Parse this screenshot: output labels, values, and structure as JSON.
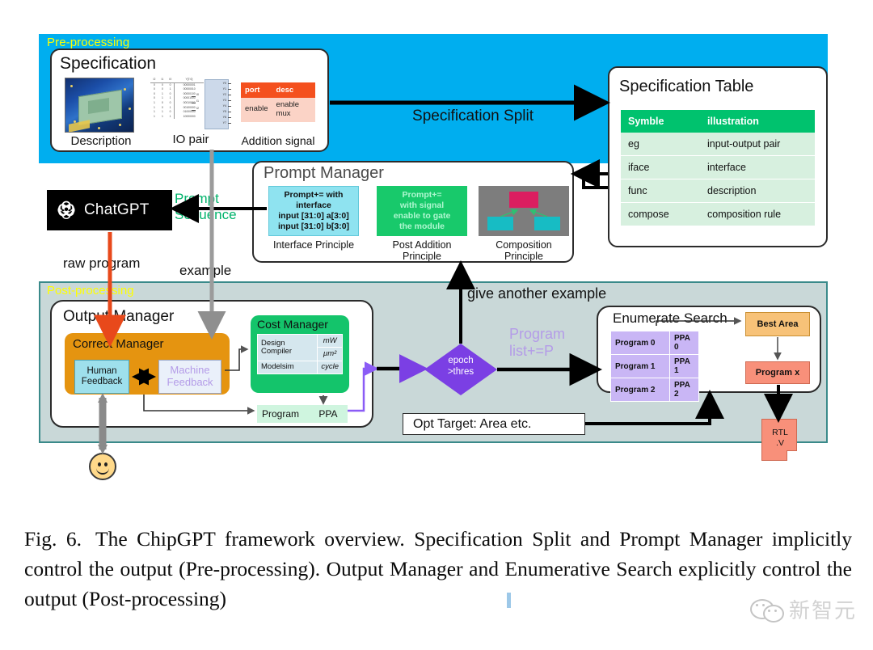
{
  "figure": {
    "pre_processing": {
      "band_label": "Pre-processing",
      "band_color": "#00AEEF",
      "label_color": "#FFFF00",
      "specification": {
        "title": "Specification",
        "items": [
          {
            "name": "description",
            "caption": "Description"
          },
          {
            "name": "io-pair",
            "caption": "IO pair"
          },
          {
            "name": "addition-signal",
            "caption": "Addition signal"
          }
        ],
        "io_pair_table": {
          "headers": [
            "I2",
            "I1",
            "I0",
            "Y[7:0]"
          ],
          "rows": [
            [
              "0",
              "0",
              "0",
              "00000001"
            ],
            [
              "0",
              "0",
              "1",
              "00000010"
            ],
            [
              "0",
              "1",
              "0",
              "00000100"
            ],
            [
              "0",
              "1",
              "1",
              "00001000"
            ],
            [
              "1",
              "0",
              "0",
              "00010000"
            ],
            [
              "1",
              "0",
              "1",
              "00100000"
            ],
            [
              "1",
              "1",
              "0",
              "01000000"
            ],
            [
              "1",
              "1",
              "1",
              "10000000"
            ]
          ],
          "inputs": [
            "I0",
            "I1",
            "I2"
          ],
          "outputs": [
            "Y0",
            "Y1",
            "Y2",
            "Y3",
            "Y4",
            "Y5",
            "Y6",
            "Y7"
          ]
        },
        "addition_signal_table": {
          "headers": [
            "port",
            "desc"
          ],
          "rows": [
            [
              "enable",
              "enable mux"
            ]
          ],
          "header_color": "#F4501E",
          "cell_color": "#FBD3C6"
        }
      },
      "split_arrow_label": "Specification Split",
      "specification_table": {
        "title": "Specification Table",
        "headers": [
          "Symble",
          "illustration"
        ],
        "header_color": "#00C26E",
        "rows": [
          [
            "eg",
            "input-output pair"
          ],
          [
            "iface",
            "interface"
          ],
          [
            "func",
            "description"
          ],
          [
            "compose",
            "composition rule"
          ]
        ]
      },
      "prompt_manager": {
        "title": "Prompt Manager",
        "principles": [
          {
            "box_text": "Prompt+= with interface\ninput [31:0] a[3:0]\ninput [31:0] b[3:0]",
            "box_lines": [
              "Prompt+= with",
              "interface",
              "input [31:0] a[3:0]",
              "input [31:0] b[3:0]"
            ],
            "caption": "Interface Principle",
            "color": "#8FE3F0"
          },
          {
            "box_lines": [
              "Prompt+=",
              "with signal",
              "enable to gate",
              "the module"
            ],
            "caption": "Post Addition Principle",
            "color": "#18C96B"
          },
          {
            "box_lines": [],
            "caption": "Composition Principle",
            "color": "#7d7d7d"
          }
        ]
      }
    },
    "chatgpt": {
      "label": "ChatGPT",
      "prompt_sequence_label": "Prompt Sequence",
      "prompt_sequence_color": "#00B36B",
      "raw_program_label": "raw program",
      "example_label": "example"
    },
    "post_processing": {
      "band_label": "Post-processing",
      "band_color": "#C9D8D8",
      "label_color": "#FFFF00",
      "output_manager": {
        "title": "Output Manager",
        "correct_manager": {
          "title": "Correct Manager",
          "color": "#E59410",
          "human_feedback": "Human Feedback",
          "machine_feedback": "Machine Feedback"
        },
        "cost_manager": {
          "title": "Cost Manager",
          "color": "#14C46B",
          "rows": [
            {
              "tool": "Design Compiler",
              "units": [
                "mW",
                "μm²"
              ]
            },
            {
              "tool": "Modelsim",
              "units": [
                "cycle"
              ]
            }
          ]
        },
        "program_ppa": {
          "program": "Program",
          "ppa": "PPA"
        }
      },
      "decision": {
        "line1": "epoch",
        "line2": ">thres",
        "color": "#7B3FE4"
      },
      "program_list_label": "Program list+=P",
      "program_list_lines": [
        "Program",
        "list+=P"
      ],
      "program_list_color": "#B49CE8",
      "give_another_example": "give another example",
      "enumerate_search": {
        "title": "Enumerate Search",
        "rows": [
          [
            "Program 0",
            "PPA 0"
          ],
          [
            "Program 1",
            "PPA 1"
          ],
          [
            "Program 2",
            "PPA 2"
          ]
        ],
        "row_color": "#C9B6F5",
        "best_area": "Best Area",
        "program_x": "Program x"
      },
      "opt_target": "Opt Target: Area etc.",
      "rtl_file": {
        "line1": "RTL",
        "line2": ".V"
      }
    }
  },
  "caption": {
    "label": "Fig. 6.",
    "text": "The ChipGPT framework overview. Specification Split and Prompt Manager implicitly control the output (Pre-processing). Output Manager and Enumerative Search explicitly control the output (Post-processing)"
  },
  "watermark": {
    "text": "新智元"
  }
}
